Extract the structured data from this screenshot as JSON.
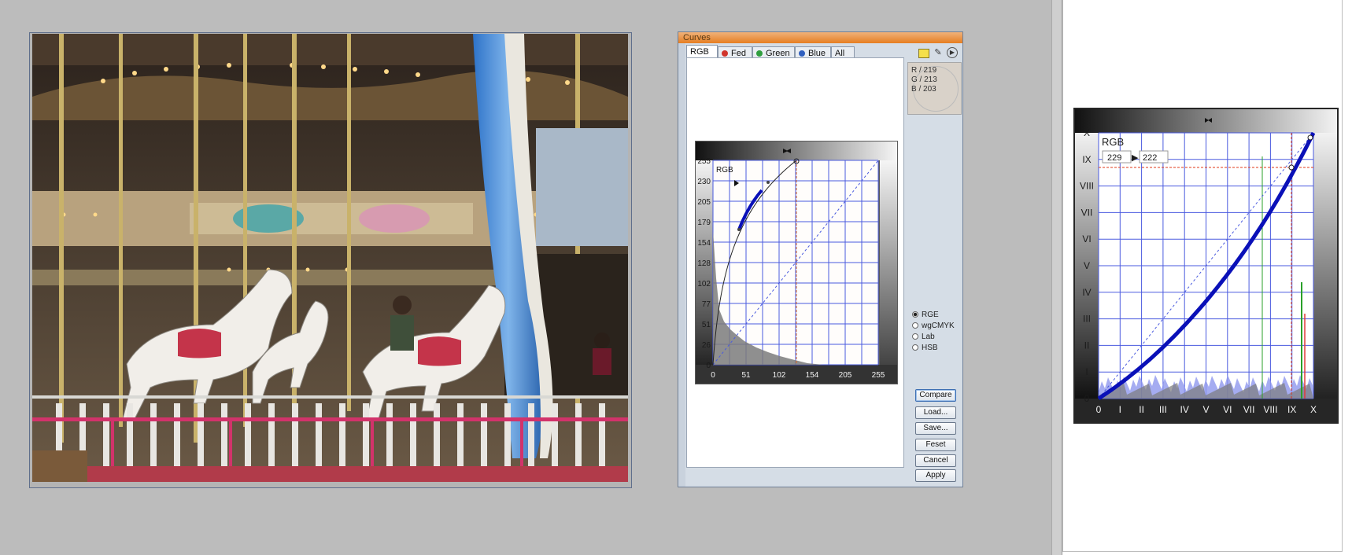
{
  "dialog": {
    "title": "Curves",
    "tabs": [
      {
        "label": "RGB",
        "dot": null
      },
      {
        "label": "Fed",
        "dot": "#d0342c"
      },
      {
        "label": "Green",
        "dot": "#2f9e3f"
      },
      {
        "label": "Blue",
        "dot": "#2f5fbf"
      },
      {
        "label": "All",
        "dot": null
      }
    ],
    "sample": {
      "r": "R / 219",
      "g": "G / 213",
      "b": "B / 203"
    },
    "curve": {
      "channel_label": "RGB",
      "y_ticks": [
        "255",
        "230",
        "205",
        "179",
        "154",
        "128",
        "102",
        "77",
        "51",
        "26",
        "0"
      ],
      "x_ticks": [
        "0",
        "51",
        "102",
        "154",
        "205",
        "255"
      ]
    },
    "color_spaces": [
      {
        "label": "RGE",
        "selected": true
      },
      {
        "label": "wgCMYK",
        "selected": false
      },
      {
        "label": "Lab",
        "selected": false
      },
      {
        "label": "HSB",
        "selected": false
      }
    ],
    "buttons": [
      "Compare",
      "Load...",
      "Save...",
      "Feset",
      "Cancel",
      "Apply"
    ]
  },
  "zoom_curve": {
    "channel_label": "RGB",
    "input_value": "229",
    "output_value": "222",
    "arrow": "▶",
    "roman_ticks": [
      "0",
      "I",
      "II",
      "III",
      "IV",
      "V",
      "VI",
      "VII",
      "VIII",
      "IX",
      "X"
    ]
  },
  "colors": {
    "curve": "#0a10b8",
    "grid": "#4a5adf",
    "guide": "#e03a1a",
    "title_bar": "#e67e22"
  }
}
